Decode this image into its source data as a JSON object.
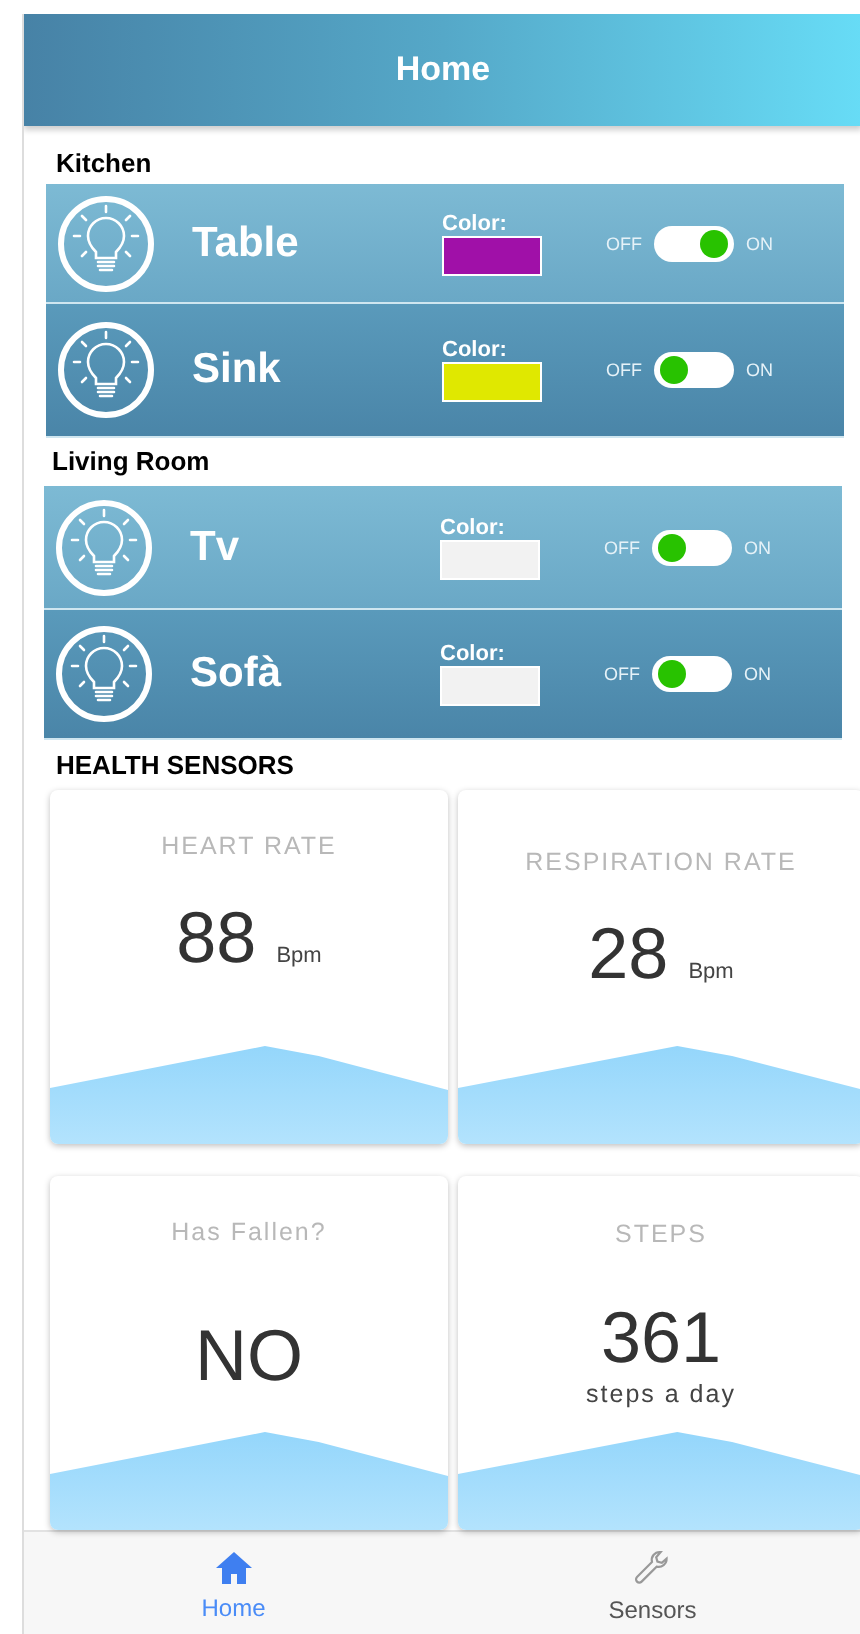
{
  "header": {
    "title": "Home"
  },
  "rooms": [
    {
      "name": "Kitchen",
      "lights": [
        {
          "name": "Table",
          "color_label": "Color:",
          "color": "#a010a8",
          "off_label": "OFF",
          "on_label": "ON",
          "on": true
        },
        {
          "name": "Sink",
          "color_label": "Color:",
          "color": "#e0e800",
          "off_label": "OFF",
          "on_label": "ON",
          "on": false
        }
      ]
    },
    {
      "name": "Living Room",
      "lights": [
        {
          "name": "Tv",
          "color_label": "Color:",
          "color": "#f2f2f2",
          "off_label": "OFF",
          "on_label": "ON",
          "on": false
        },
        {
          "name": "Sofà",
          "color_label": "Color:",
          "color": "#f2f2f2",
          "off_label": "OFF",
          "on_label": "ON",
          "on": false
        }
      ]
    }
  ],
  "health": {
    "title": "HEALTH SENSORS",
    "cards": [
      {
        "label": "HEART RATE",
        "value": "88",
        "unit": "Bpm"
      },
      {
        "label": "RESPIRATION RATE",
        "value": "28",
        "unit": "Bpm"
      },
      {
        "label": "Has Fallen?",
        "value": "NO"
      },
      {
        "label": "STEPS",
        "value": "361",
        "caption": "steps a day"
      }
    ]
  },
  "nav": [
    {
      "label": "Home",
      "selected": true
    },
    {
      "label": "Sensors",
      "selected": false
    }
  ]
}
